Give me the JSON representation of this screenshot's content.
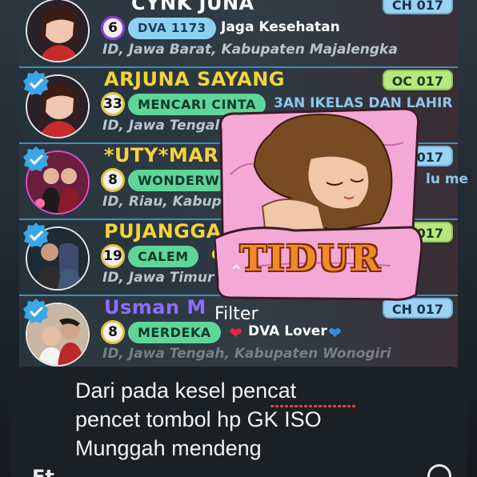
{
  "rows": [
    {
      "name": "CYNK  JUNA",
      "name_color": "#ffffff",
      "level": "6",
      "badge": "DVA 1173",
      "motto": "Jaga Kesehatan",
      "location": "ID, Jawa Barat, Kabupaten Majalengka",
      "tag": "CH 017"
    },
    {
      "name": "ARJUNA SAYANG",
      "name_color": "#f2d33a",
      "level": "33",
      "badge": "MENCARI CINTA",
      "motto": "3AN  IKELAS DAN LAHIR",
      "location": "ID, Jawa Tengal",
      "tag": "OC 017"
    },
    {
      "name": "*UTY*MARI",
      "name_color": "#f2d33a",
      "level": "8",
      "badge": "WONDERW",
      "motto": "lu me",
      "location": "ID, Riau, Kabup",
      "tag": "017"
    },
    {
      "name": "PUJANGGA (",
      "name_color": "#f2d33a",
      "level": "19",
      "badge": "CALEM",
      "motto": "Ca",
      "location": "ID, Jawa Timur",
      "tag": "OC 017"
    },
    {
      "name": "Usman M",
      "name_color": "#8d6cff",
      "level": "8",
      "badge": "MERDEKA",
      "motto": "DVA Lover",
      "location": "ID, Jawa Tengah, Kabupaten Wonogiri",
      "tag": "CH 017"
    }
  ],
  "sticker": {
    "text": "TIDUR"
  },
  "filter_label": "Filter",
  "composer": {
    "text": "Dari pada kesel pencat\npencet tombol hp  GK ISO\nMunggah mendeng\n...",
    "format_icon": "Ft"
  },
  "colors": {
    "row_divider": "#3d8fb8",
    "badge_green": "#5fd59a",
    "tag_oc": "#b7e87d",
    "tag_ch": "#9bd2f2",
    "sticker_text": "#f08a2b"
  }
}
